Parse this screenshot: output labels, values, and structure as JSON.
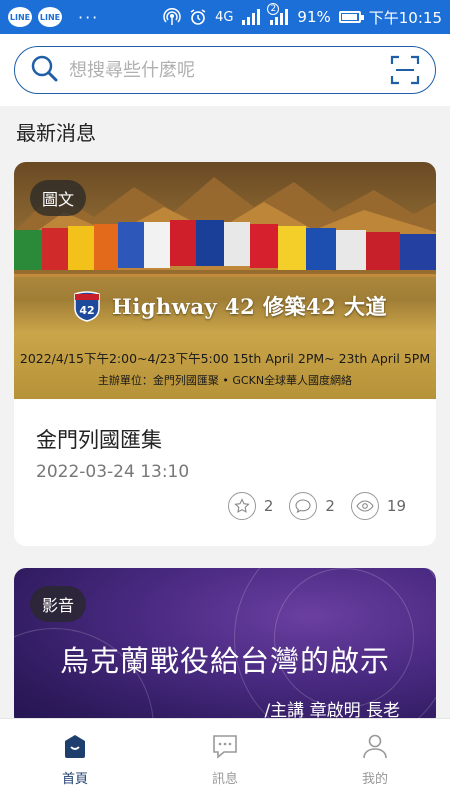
{
  "status_bar": {
    "line_label": "LINE",
    "dots": "···",
    "network": "4G",
    "sim_badge": "2",
    "battery": "91%",
    "time": "下午10:15",
    "battery_level": 0.91
  },
  "search": {
    "placeholder": "想搜尋些什麼呢"
  },
  "section": {
    "title": "最新消息"
  },
  "cards": [
    {
      "badge": "圖文",
      "banner_title": "Highway 42  修築42 大道",
      "shield_number": "42",
      "banner_dates": "2022/4/15下午2:00~4/23下午5:00   15th April 2PM~ 23th April 5PM",
      "banner_org": "主辦單位：金門列國匯聚 • GCKN全球華人國度網絡",
      "title": "金門列國匯集",
      "date": "2022-03-24 13:10",
      "likes": "2",
      "comments": "2",
      "views": "19"
    },
    {
      "badge": "影音",
      "banner_title": "烏克蘭戰役給台灣的啟示",
      "banner_subtitle": "/主講 章啟明 長老"
    }
  ],
  "nav": [
    {
      "label": "首頁"
    },
    {
      "label": "訊息"
    },
    {
      "label": "我的"
    }
  ],
  "colors": {
    "status_bar": "#1d6fd8",
    "accent": "#1e3f6e",
    "search_border": "#1e5fa8"
  }
}
